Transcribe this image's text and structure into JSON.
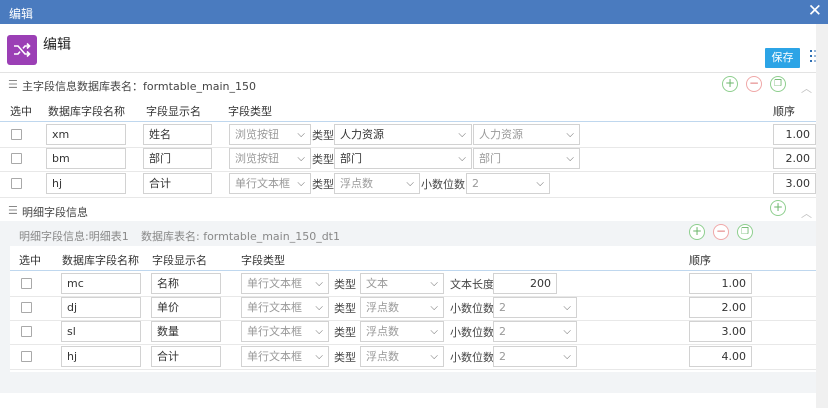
{
  "window": {
    "title": "编辑",
    "close": "✕"
  },
  "header": {
    "title": "编辑",
    "app_icon": "shuffle-icon",
    "save": "保存",
    "list_icon": "list-icon"
  },
  "main_section": {
    "label": "主字段信息数据库表名：formtable_main_150",
    "columns": [
      "选中",
      "数据库字段名称",
      "字段显示名",
      "字段类型",
      "顺序"
    ],
    "type_label": "类型",
    "decimal_label": "小数位数",
    "rows": [
      {
        "db": "xm",
        "display": "姓名",
        "fieldtype": "浏览按钮",
        "subtype": "人力资源",
        "extra": "人力资源",
        "order": "1.00"
      },
      {
        "db": "bm",
        "display": "部门",
        "fieldtype": "浏览按钮",
        "subtype": "部门",
        "extra": "部门",
        "order": "2.00"
      },
      {
        "db": "hj",
        "display": "合计",
        "fieldtype": "单行文本框",
        "subtype": "浮点数",
        "extra": "2",
        "order": "3.00"
      }
    ]
  },
  "detail_section": {
    "label": "明细字段信息",
    "caption_left": "明细字段信息:明细表1",
    "caption_right": "数据库表名:  formtable_main_150_dt1",
    "columns": [
      "选中",
      "数据库字段名称",
      "字段显示名",
      "字段类型",
      "顺序"
    ],
    "type_label": "类型",
    "text_length_label": "文本长度",
    "decimal_label": "小数位数",
    "rows": [
      {
        "db": "mc",
        "display": "名称",
        "fieldtype": "单行文本框",
        "subtype": "文本",
        "extra": "200",
        "order": "1.00"
      },
      {
        "db": "dj",
        "display": "单价",
        "fieldtype": "单行文本框",
        "subtype": "浮点数",
        "extra": "2",
        "order": "2.00"
      },
      {
        "db": "sl",
        "display": "数量",
        "fieldtype": "单行文本框",
        "subtype": "浮点数",
        "extra": "2",
        "order": "3.00"
      },
      {
        "db": "hj",
        "display": "合计",
        "fieldtype": "单行文本框",
        "subtype": "浮点数",
        "extra": "2",
        "order": "4.00"
      }
    ]
  },
  "icons": {
    "plus": "+",
    "minus": "−",
    "copy": "❐",
    "caret": "︿",
    "hamburger": "☰",
    "chevron": "⌵"
  }
}
